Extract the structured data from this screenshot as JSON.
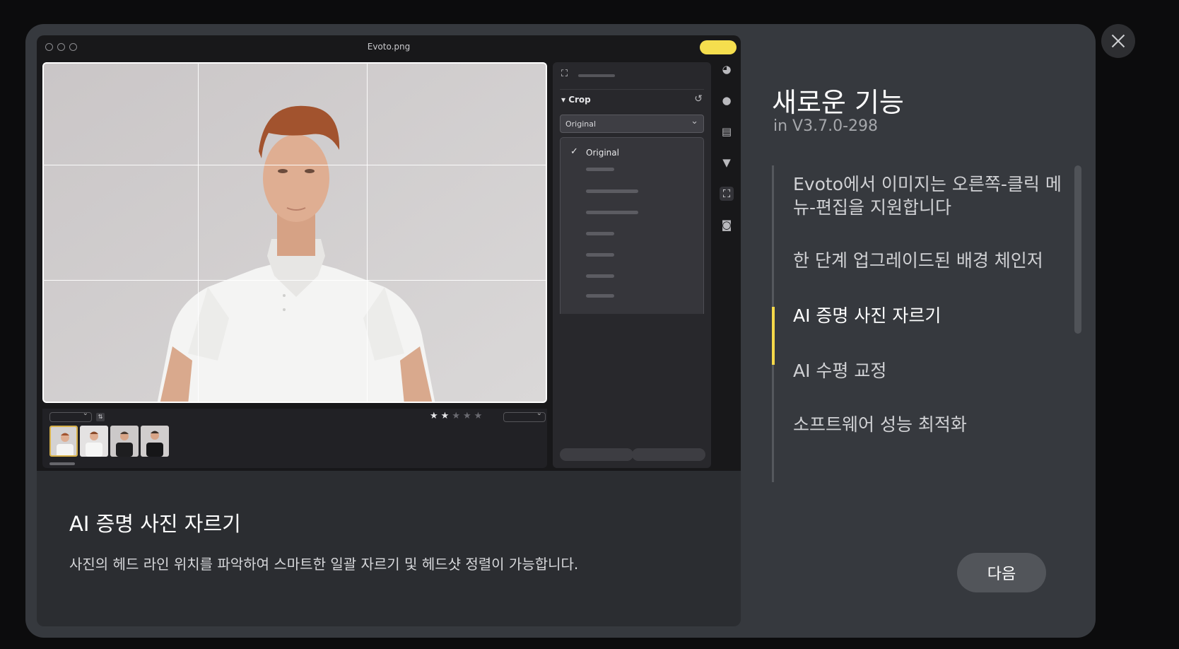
{
  "preview": {
    "window_title": "Evoto.png",
    "crop_section": {
      "label": "Crop",
      "ratio_value": "Original",
      "options": [
        "Original"
      ]
    },
    "rating": {
      "value": 2,
      "max": 5
    }
  },
  "caption": {
    "title": "AI 증명 사진 자르기",
    "description": "사진의 헤드 라인 위치를 파악하여 스마트한 일괄 자르기 및 헤드샷 정렬이 가능합니다."
  },
  "panel": {
    "title": "새로운 기능",
    "version": "in V3.7.0-298",
    "features": [
      "Evoto에서 이미지는 오른쪽-클릭 메뉴-편집을 지원합니다",
      "한 단계 업그레이드된 배경 체인저",
      "AI 증명 사진 자르기",
      "AI 수평 교정",
      "소프트웨어 성능 최적화"
    ],
    "active_index": 2,
    "next_label": "다음"
  },
  "colors": {
    "accent": "#f5d94a",
    "modal_bg": "#36393e",
    "page_bg": "#0c0c0d"
  },
  "icons": [
    "close-icon",
    "crop-icon",
    "reset-icon",
    "check-icon",
    "palette-icon",
    "face-icon",
    "gradient-icon",
    "shirt-icon",
    "camera-icon",
    "star-icon",
    "sort-icon"
  ]
}
